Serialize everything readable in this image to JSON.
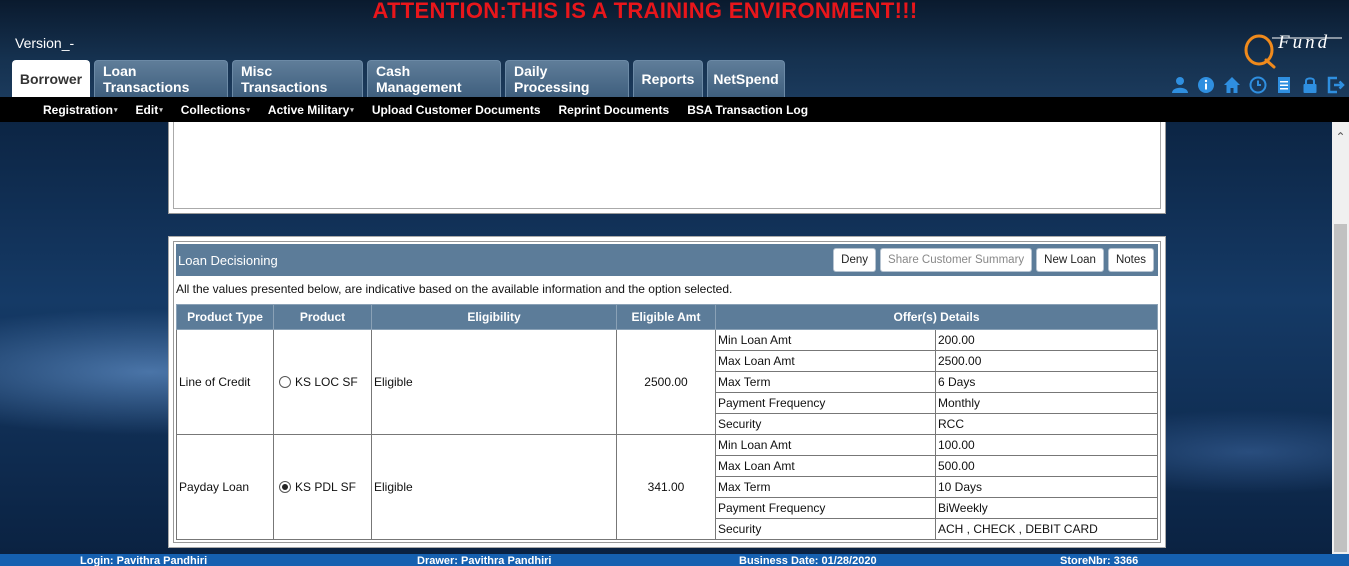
{
  "banner": "ATTENTION:THIS IS A TRAINING ENVIRONMENT!!!",
  "version": "Version_-",
  "logo_text": "Fund",
  "tabs": [
    {
      "label": "Borrower"
    },
    {
      "label": "Loan Transactions"
    },
    {
      "label": "Misc Transactions"
    },
    {
      "label": "Cash Management"
    },
    {
      "label": "Daily Processing"
    },
    {
      "label": "Reports"
    },
    {
      "label": "NetSpend"
    }
  ],
  "util_icons": [
    "user-icon",
    "info-icon",
    "home-icon",
    "clock-icon",
    "document-icon",
    "lock-icon",
    "logout-icon"
  ],
  "subnav": [
    {
      "label": "Registration"
    },
    {
      "label": "Edit"
    },
    {
      "label": "Collections"
    },
    {
      "label": "Active Military"
    },
    {
      "label": "Upload Customer Documents"
    },
    {
      "label": "Reprint Documents"
    },
    {
      "label": "BSA Transaction Log"
    }
  ],
  "decisioning": {
    "title": "Loan Decisioning",
    "buttons": {
      "deny": "Deny",
      "share": "Share Customer Summary",
      "new_loan": "New Loan",
      "notes": "Notes"
    },
    "note": "All the values presented below, are indicative based on the available information and the option selected.",
    "columns": [
      "Product Type",
      "Product",
      "Eligibility",
      "Eligible Amt",
      "Offer(s) Details"
    ],
    "rows": [
      {
        "product_type": "Line of Credit",
        "product": "KS LOC SF",
        "selected": false,
        "eligibility": "Eligible",
        "eligible_amt": "2500.00",
        "offers": [
          {
            "k": "Min Loan Amt",
            "v": "200.00"
          },
          {
            "k": "Max Loan Amt",
            "v": "2500.00"
          },
          {
            "k": "Max Term",
            "v": "6 Days"
          },
          {
            "k": "Payment Frequency",
            "v": "Monthly"
          },
          {
            "k": "Security",
            "v": "RCC"
          }
        ]
      },
      {
        "product_type": "Payday Loan",
        "product": "KS PDL SF",
        "selected": true,
        "eligibility": "Eligible",
        "eligible_amt": "341.00",
        "offers": [
          {
            "k": "Min Loan Amt",
            "v": "100.00"
          },
          {
            "k": "Max Loan Amt",
            "v": "500.00"
          },
          {
            "k": "Max Term",
            "v": "10 Days"
          },
          {
            "k": "Payment Frequency",
            "v": "BiWeekly"
          },
          {
            "k": "Security",
            "v": "ACH , CHECK , DEBIT CARD"
          }
        ]
      }
    ]
  },
  "footer": {
    "login": "Login: Pavithra Pandhiri",
    "drawer": "Drawer: Pavithra Pandhiri",
    "business_date": "Business Date: 01/28/2020",
    "store": "StoreNbr: 3366"
  }
}
